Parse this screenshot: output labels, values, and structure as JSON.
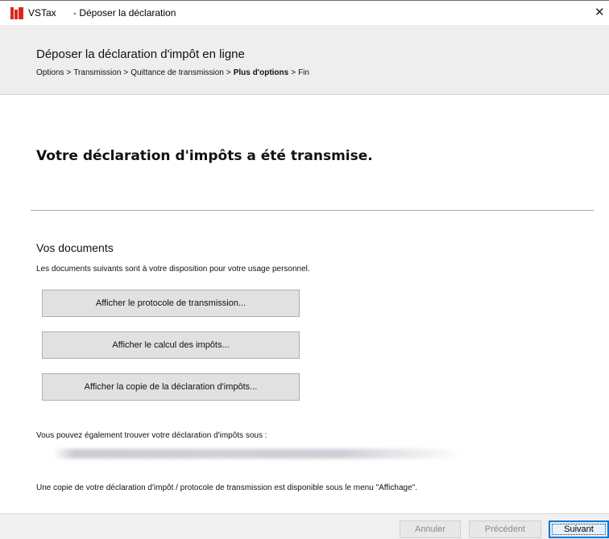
{
  "titlebar": {
    "app_name": "VSTax",
    "title": "- Déposer la déclaration",
    "close_symbol": "✕"
  },
  "header": {
    "title": "Déposer la déclaration d'impôt en ligne",
    "breadcrumb": {
      "steps": [
        "Options",
        "Transmission",
        "Quittance de transmission",
        "Plus d'options",
        "Fin"
      ],
      "separator": ">",
      "current_index": 3
    }
  },
  "main": {
    "success_heading": "Votre déclaration d'impôts a été transmise.",
    "documents": {
      "title": "Vos documents",
      "description": "Les documents suivants sont à votre disposition pour votre usage personnel.",
      "buttons": [
        "Afficher le protocole de transmission...",
        "Afficher le calcul des impôts...",
        "Afficher la copie de la déclaration d'impôts..."
      ]
    },
    "location_text": "Vous pouvez également trouver votre déclaration d'impôts sous :",
    "copy_note": "Une copie de votre déclaration d'impôt / protocole de transmission est disponible sous le menu \"Affichage\"."
  },
  "footer": {
    "cancel_label": "Annuler",
    "prev_label": "Précédent",
    "next_label": "Suivant"
  },
  "colors": {
    "accent": "#0078d7",
    "header_bg": "#eeeeee",
    "brand_red": "#d8291c"
  }
}
